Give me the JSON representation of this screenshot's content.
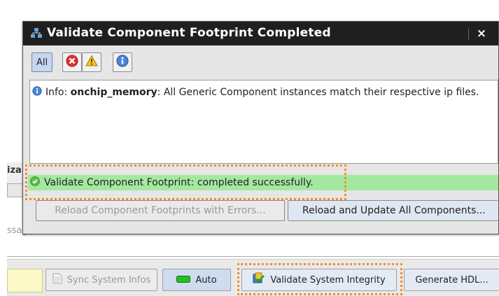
{
  "dialog": {
    "title": "Validate Component Footprint Completed",
    "close_glyph": "×",
    "filters": {
      "all_label": "All"
    },
    "message": {
      "prefix": "Info:",
      "component": "onchip_memory",
      "text": ": All Generic Component instances match their respective ip files."
    },
    "status_text": "Validate Component Footprint: completed successfully.",
    "buttons": {
      "reload_errors": "Reload Component Footprints with Errors...",
      "reload_all": "Reload and Update All Components..."
    }
  },
  "background": {
    "partial_label": "iza",
    "partial_text": "ssage)"
  },
  "toolbar": {
    "sync_label": "Sync System Infos",
    "auto_label": "Auto",
    "validate_label": "Validate System Integrity",
    "generate_label": "Generate HDL..."
  },
  "colors": {
    "success_bar": "#a4e8a0",
    "highlight_dots": "#f0902a",
    "titlebar": "#1f1f1f",
    "auto_indicator": "#22c022"
  },
  "icons": [
    "app-icon",
    "error-filter-icon",
    "warning-filter-icon",
    "info-filter-icon",
    "info-icon",
    "success-check-icon",
    "sync-icon",
    "auto-indicator-icon",
    "validate-icon"
  ]
}
